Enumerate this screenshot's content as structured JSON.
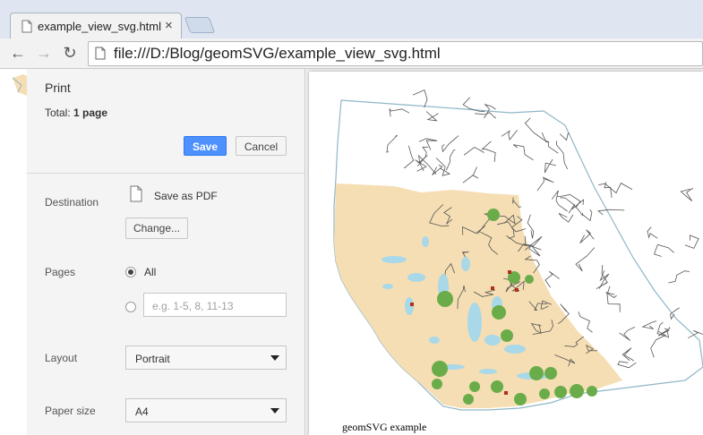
{
  "browser": {
    "tab_title": "example_view_svg.html",
    "close_glyph": "×",
    "back_glyph": "←",
    "forward_glyph": "→",
    "reload_glyph": "↻",
    "url": "file:///D:/Blog/geomSVG/example_view_svg.html"
  },
  "print": {
    "heading": "Print",
    "total_label": "Total:",
    "total_value": "1 page",
    "save_label": "Save",
    "cancel_label": "Cancel",
    "destination_label": "Destination",
    "destination_value": "Save as PDF",
    "change_label": "Change...",
    "pages_label": "Pages",
    "pages_all_label": "All",
    "pages_all_selected": true,
    "pages_custom_placeholder": "e.g. 1-5, 8, 11-13",
    "layout_label": "Layout",
    "layout_value": "Portrait",
    "paper_label": "Paper size",
    "paper_value": "A4"
  },
  "preview": {
    "caption": "geomSVG example",
    "colors": {
      "region_fill": "#f5deb3",
      "boundary": "#555555",
      "water": "#a9d8e8",
      "outline": "#8fb6c8",
      "circle": "#6aac4a",
      "marker": "#b0301a"
    }
  }
}
